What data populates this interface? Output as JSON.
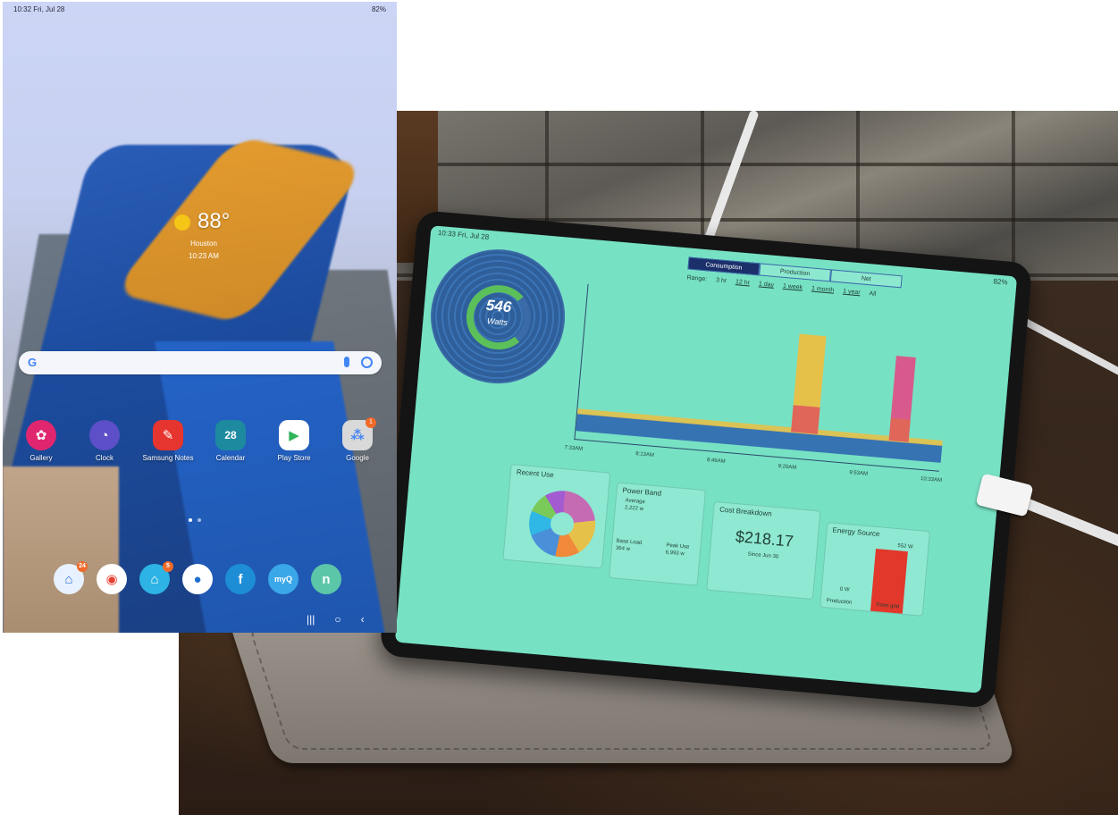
{
  "status_bar": {
    "time_date": "10:32  Fri, Jul 28",
    "battery": "82%"
  },
  "weather": {
    "temperature": "88°",
    "location": "Houston",
    "time": "10:23 AM",
    "icon": "sun-icon"
  },
  "search_bar": {
    "logo": "G"
  },
  "apps": [
    {
      "label": "Gallery",
      "icon": "gallery-icon",
      "color": "#e0266f",
      "glyph": "✿"
    },
    {
      "label": "Clock",
      "icon": "clock-icon",
      "color": "#5c4fc7",
      "glyph": "◔"
    },
    {
      "label": "Samsung Notes",
      "icon": "notes-icon",
      "color": "#e5352e",
      "glyph": "✎"
    },
    {
      "label": "Calendar",
      "icon": "calendar-icon",
      "color": "#1d8aa0",
      "glyph": "28"
    },
    {
      "label": "Play Store",
      "icon": "play-store-icon",
      "color": "#ffffff",
      "glyph": "▶"
    },
    {
      "label": "Google",
      "icon": "google-folder-icon",
      "color": "#d9d9d9",
      "glyph": "⁂",
      "badge": "1"
    }
  ],
  "dock": [
    {
      "icon": "smartthings-icon",
      "color": "#e8f1ff",
      "glyph": "⌂",
      "badge": "24"
    },
    {
      "icon": "chrome-icon",
      "color": "#e34133",
      "glyph": "◉"
    },
    {
      "icon": "home-icon",
      "color": "#2db3e5",
      "glyph": "⌂",
      "badge": "5"
    },
    {
      "icon": "water-drop-icon",
      "color": "#1f6fd1",
      "glyph": "💧"
    },
    {
      "icon": "f-app-icon",
      "color": "#1d8dd6",
      "glyph": "f"
    },
    {
      "icon": "myq-icon",
      "color": "#3aa7e8",
      "glyph": "myQ"
    },
    {
      "icon": "n-app-icon",
      "color": "#5cc6a8",
      "glyph": "n"
    }
  ],
  "nav": {
    "recents": "|||",
    "home": "○",
    "back": "‹"
  },
  "tablet_dashboard": {
    "status_time": "10:33  Fri, Jul 28",
    "battery": "82%",
    "gauge_value": "546",
    "gauge_unit": "Watts",
    "tabs": [
      "Consumption",
      "Production",
      "Net"
    ],
    "range_label": "Range:",
    "ranges": [
      "3 hr",
      "12 hr",
      "1 day",
      "1 week",
      "1 month",
      "1 year",
      "All"
    ],
    "x_ticks": [
      "7:33AM",
      "8:13AM",
      "8:46AM",
      "9:20AM",
      "9:53AM",
      "10:33AM"
    ],
    "cards": {
      "recent_use": "Recent Use",
      "power_band": "Power Band",
      "power_band_avg": "Average",
      "power_band_avg_val": "2,222 w",
      "power_band_base": "Base Load",
      "power_band_base_val": "364 w",
      "power_band_peak": "Peak Use",
      "power_band_peak_val": "6,993 w",
      "cost_breakdown": "Cost Breakdown",
      "cost_value": "$218.17",
      "cost_since": "Since Jun 30",
      "energy_source": "Energy Source",
      "energy_top": "552 W",
      "energy_zero": "0 W",
      "production": "Production",
      "from_grid": "From grid"
    }
  }
}
